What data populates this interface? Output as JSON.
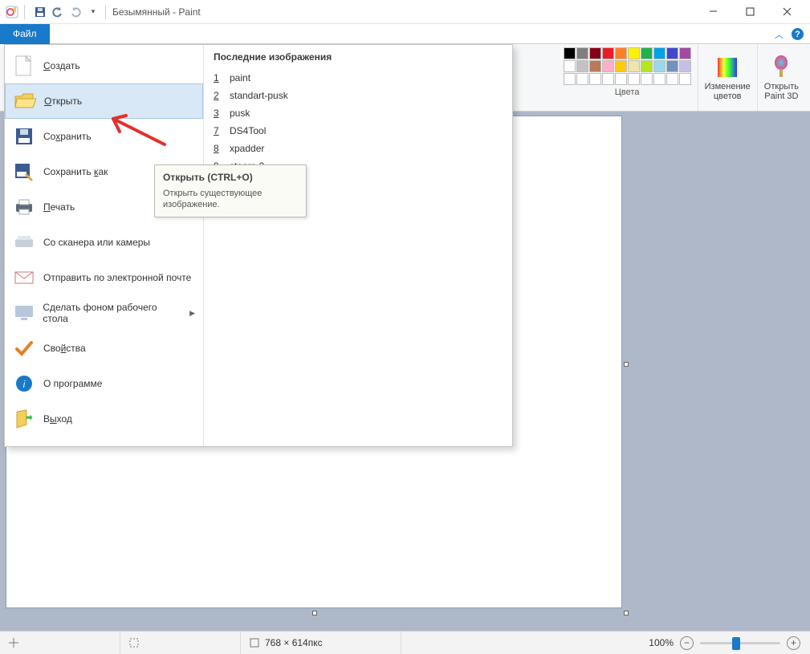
{
  "title": "Безымянный - Paint",
  "file_tab": "Файл",
  "colors_label": "Цвета",
  "edit_colors": "Изменение\nцветов",
  "open_3d": "Открыть\nPaint 3D",
  "swatch_rows": [
    [
      "#000000",
      "#7f7f7f",
      "#880015",
      "#ed1c24",
      "#ff7f27",
      "#fff200",
      "#22b14c",
      "#00a2e8",
      "#3f48cc",
      "#a349a4"
    ],
    [
      "#ffffff",
      "#c3c3c3",
      "#b97a57",
      "#ffaec9",
      "#ffc90e",
      "#efe4b0",
      "#b5e61d",
      "#99d9ea",
      "#7092be",
      "#c8bfe7"
    ],
    [
      "#ffffff",
      "#ffffff",
      "#ffffff",
      "#ffffff",
      "#ffffff",
      "#ffffff",
      "#ffffff",
      "#ffffff",
      "#ffffff",
      "#ffffff"
    ]
  ],
  "menu": {
    "create": "Создать",
    "open": "Открыть",
    "save": "Сохранить",
    "saveas": "Сохранить как",
    "print": "Печать",
    "scanner": "Со сканера или камеры",
    "email": "Отправить по электронной почте",
    "wallpaper": "Сделать фоном рабочего стола",
    "props": "Свойства",
    "about": "О программе",
    "exit": "Выход"
  },
  "recent_header": "Последние изображения",
  "recent": [
    {
      "n": "1",
      "name": "paint"
    },
    {
      "n": "2",
      "name": "standart-pusk"
    },
    {
      "n": "3",
      "name": "pusk"
    },
    {
      "n": "7",
      "name": "DS4Tool"
    },
    {
      "n": "8",
      "name": "xpadder"
    },
    {
      "n": "9",
      "name": "steam-3"
    }
  ],
  "tooltip": {
    "title": "Открыть (CTRL+O)",
    "body": "Открыть существующее изображение."
  },
  "status": {
    "dims": "768 × 614пкс",
    "zoom": "100%"
  }
}
